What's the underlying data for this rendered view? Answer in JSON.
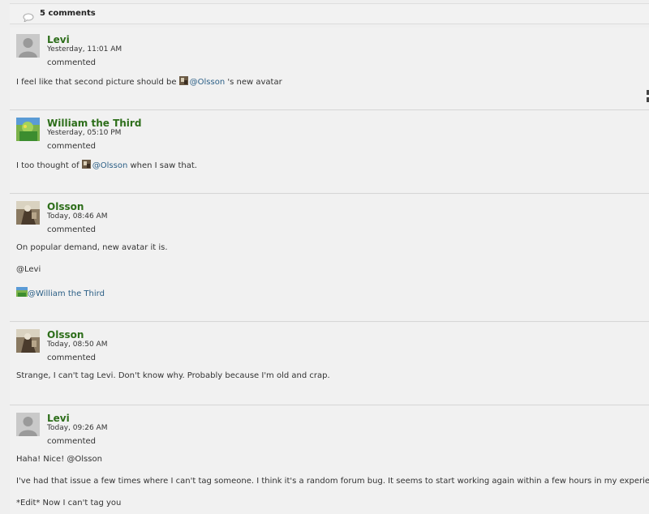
{
  "header": {
    "comment_count": "5 comments"
  },
  "comments": [
    {
      "author": "Levi",
      "time": "Yesterday, 11:01 AM",
      "action": "commented",
      "lines": [
        {
          "text_before": "I feel like that second picture should be ",
          "mention": "@Olsson",
          "text_after": " 's new avatar"
        }
      ]
    },
    {
      "author": "William the Third",
      "time": "Yesterday, 05:10 PM",
      "action": "commented",
      "lines": [
        {
          "text_before": "I too thought of ",
          "mention": "@Olsson",
          "text_after": " when I saw that."
        }
      ]
    },
    {
      "author": "Olsson",
      "time": "Today, 08:46 AM",
      "action": "commented",
      "lines": [
        {
          "text": "On popular demand, new avatar it is."
        },
        {
          "text": "@Levi"
        },
        {
          "mention": "@William the Third"
        }
      ]
    },
    {
      "author": "Olsson",
      "time": "Today, 08:50 AM",
      "action": "commented",
      "lines": [
        {
          "text": "Strange, I can't tag Levi. Don't know why. Probably because I'm old and crap."
        }
      ]
    },
    {
      "author": "Levi",
      "time": "Today, 09:26 AM",
      "action": "commented",
      "lines": [
        {
          "text": "Haha! Nice! @Olsson"
        },
        {
          "text": "I've had that issue a few times where I can't tag someone. I think it's a random forum bug. It seems to start working again within a few hours in my experience."
        },
        {
          "text": "*Edit* Now I can't tag you"
        }
      ]
    }
  ]
}
